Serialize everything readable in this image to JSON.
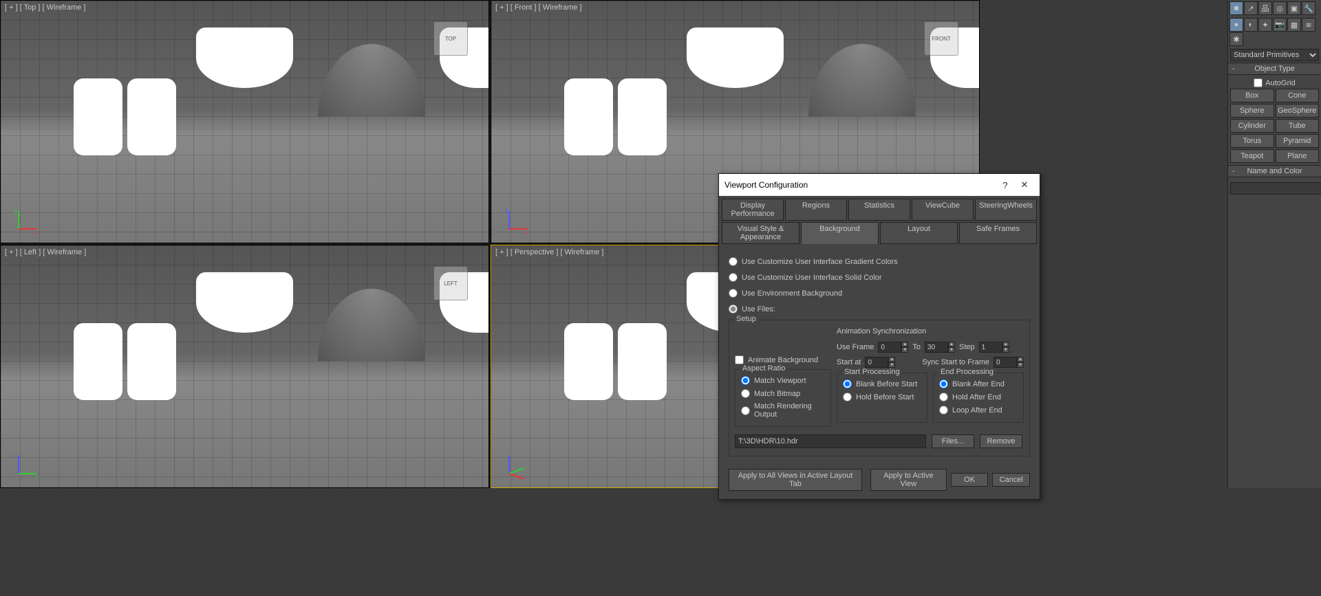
{
  "viewports": {
    "top": "[ + ] [ Top ] [ Wireframe ]",
    "front": "[ + ] [ Front ] [ Wireframe ]",
    "left": "[ + ] [ Left ] [ Wireframe ]",
    "persp": "[ + ] [ Perspective ] [ Wireframe ]",
    "cube_top": "TOP",
    "cube_front": "FRONT",
    "cube_left": "LEFT"
  },
  "panel": {
    "dropdown": "Standard Primitives",
    "objtype_head": "Object Type",
    "autogrid": "AutoGrid",
    "buttons": [
      "Box",
      "Cone",
      "Sphere",
      "GeoSphere",
      "Cylinder",
      "Tube",
      "Torus",
      "Pyramid",
      "Teapot",
      "Plane"
    ],
    "namecolor_head": "Name and Color",
    "swatch_color": "#e055c0"
  },
  "dialog": {
    "title": "Viewport Configuration",
    "tabs_row1": [
      "Display Performance",
      "Regions",
      "Statistics",
      "ViewCube",
      "SteeringWheels"
    ],
    "tabs_row2": [
      "Visual Style & Appearance",
      "Background",
      "Layout",
      "Safe Frames"
    ],
    "active_tab": "Background",
    "radios": {
      "r1": "Use Customize User Interface Gradient Colors",
      "r2": "Use Customize User Interface Solid Color",
      "r3": "Use Environment Background",
      "r4": "Use Files:"
    },
    "setup_title": "Setup",
    "animate_bg": "Animate Background",
    "anim_sync_title": "Animation Synchronization",
    "use_frame": "Use Frame",
    "use_frame_v": "0",
    "to": "To",
    "to_v": "30",
    "step": "Step",
    "step_v": "1",
    "start_at": "Start at",
    "start_at_v": "0",
    "sync_start": "Sync Start to Frame",
    "sync_start_v": "0",
    "aspect_title": "Aspect Ratio",
    "aspect": {
      "a1": "Match Viewport",
      "a2": "Match Bitmap",
      "a3": "Match Rendering Output"
    },
    "startproc_title": "Start Processing",
    "startproc": {
      "s1": "Blank Before Start",
      "s2": "Hold Before Start"
    },
    "endproc_title": "End Processing",
    "endproc": {
      "e1": "Blank After End",
      "e2": "Hold After End",
      "e3": "Loop After End"
    },
    "file_path": "T:\\3D\\HDR\\10.hdr",
    "files_btn": "Files...",
    "remove_btn": "Remove",
    "apply_all": "Apply to All Views in Active Layout Tab",
    "apply_active": "Apply to Active View",
    "ok": "OK",
    "cancel": "Cancel"
  }
}
